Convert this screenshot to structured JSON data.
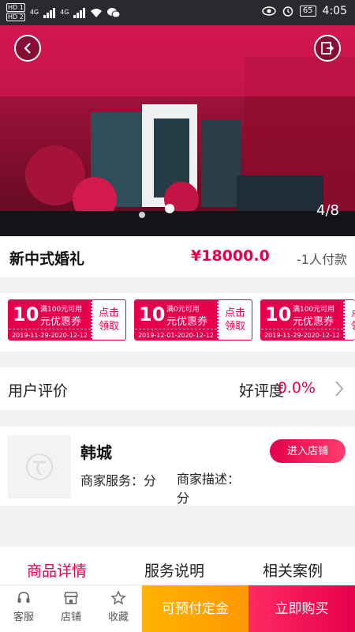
{
  "status_bar": {
    "sim1": "HD 1",
    "sim2": "HD 2",
    "net1": "4G",
    "net2": "4G",
    "battery": "65",
    "time": "4:05"
  },
  "hero": {
    "counter": "4/8",
    "back_icon": "chevron-left-icon",
    "share_icon": "share-icon"
  },
  "product": {
    "title": "新中式婚礼",
    "price": "¥18000.0",
    "people_paid": "-1人付款"
  },
  "coupons": [
    {
      "amount": "10",
      "condition": "满100元可用",
      "name": "元优惠券",
      "date": "2019-11-29-2020-12-12",
      "claim_line1": "点击",
      "claim_line2": "领取"
    },
    {
      "amount": "10",
      "condition": "满0元可用",
      "name": "元优惠券",
      "date": "2019-12-01-2020-12-12",
      "claim_line1": "点击",
      "claim_line2": "领取"
    },
    {
      "amount": "10",
      "condition": "满100元可用",
      "name": "元优惠券",
      "date": "2019-11-29-2020-12-12",
      "claim_line1": "点击",
      "claim_line2": "领取"
    }
  ],
  "reviews": {
    "label": "用户评价",
    "rating_label": "好评度",
    "rating_value": "0.0%"
  },
  "shop": {
    "name": "韩城",
    "service": "商家服务：分",
    "description": "商家描述：分",
    "enter_label": "进入店铺"
  },
  "tabs": {
    "items": [
      "商品详情",
      "服务说明",
      "相关案例"
    ],
    "active_index": 0
  },
  "bottom_bar": {
    "service_label": "客服",
    "shop_label": "店铺",
    "favorite_label": "收藏",
    "deposit_label": "可预付定金",
    "buy_label": "立即购买"
  },
  "colors": {
    "accent": "#e6004c",
    "deposit": "#ff9800",
    "buy": "#ff2a63"
  }
}
